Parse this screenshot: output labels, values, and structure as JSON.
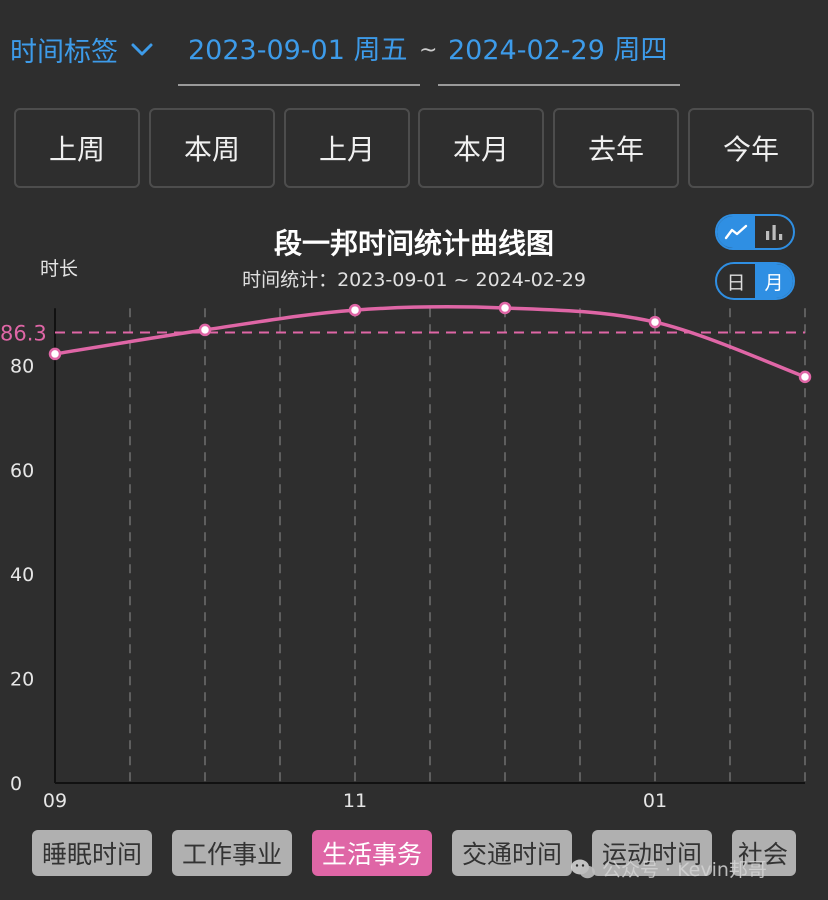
{
  "filter": {
    "tag_label": "时间标签",
    "start_date": "2023-09-01 周五",
    "separator": "~",
    "end_date": "2024-02-29 周四"
  },
  "quick_ranges": [
    "上周",
    "本周",
    "上月",
    "本月",
    "去年",
    "今年"
  ],
  "toggles": {
    "chart_type": {
      "options": [
        "line",
        "bar"
      ],
      "selected": "line"
    },
    "granularity": {
      "options": [
        "日",
        "月"
      ],
      "selected": "月"
    }
  },
  "chart_data": {
    "type": "line",
    "title": "段一邦时间统计曲线图",
    "subtitle": "时间统计：2023-09-01 ~ 2024-02-29",
    "ylabel": "时长",
    "xlabel": "",
    "ylim": [
      0,
      90
    ],
    "yticks": [
      0,
      20,
      40,
      60,
      80
    ],
    "x_tick_labels": [
      "09",
      "11",
      "01"
    ],
    "x_tick_positions": [
      0,
      2,
      4
    ],
    "x": [
      0,
      1,
      2,
      3,
      4,
      5
    ],
    "values": [
      82.2,
      86.8,
      90.6,
      91.0,
      88.3,
      77.8
    ],
    "average_line": {
      "value": 86.3,
      "label": "86.3"
    },
    "grid": "vertical-dashed",
    "color": "#df66a6"
  },
  "categories": {
    "items": [
      "睡眠时间",
      "工作事业",
      "生活事务",
      "交通时间",
      "运动时间",
      "社会"
    ],
    "selected": "生活事务"
  },
  "watermark": "公众号 · Kevin邦哥",
  "colors": {
    "accent": "#3d9be9",
    "toggle": "#2f8fe3",
    "series": "#df66a6",
    "background": "#2e2e2e"
  }
}
